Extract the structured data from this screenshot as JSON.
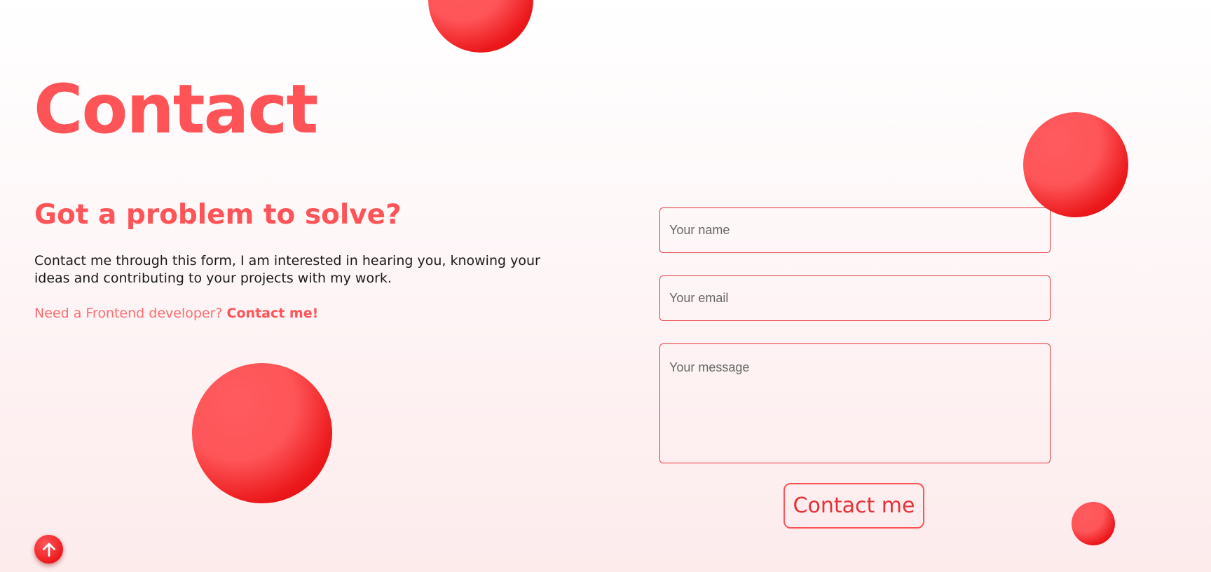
{
  "page": {
    "title": "Contact",
    "subtitle": "Got a problem to solve?",
    "intro": "Contact me through this form, I am interested in hearing you, knowing your ideas and contributing to your projects with my work.",
    "cta_prefix": "Need a Frontend developer? ",
    "cta_link": "Contact me!"
  },
  "form": {
    "name_placeholder": "Your name",
    "email_placeholder": "Your email",
    "message_placeholder": "Your message",
    "name_value": "",
    "email_value": "",
    "message_value": "",
    "submit_label": "Contact me"
  },
  "scroll_top": {
    "icon": "arrow-up-icon"
  },
  "colors": {
    "accent": "#fe5357",
    "accent_dark": "#dc0000",
    "field_border": "#e53237",
    "text": "#1a1a1a",
    "cta_light": "#fe6c70"
  }
}
